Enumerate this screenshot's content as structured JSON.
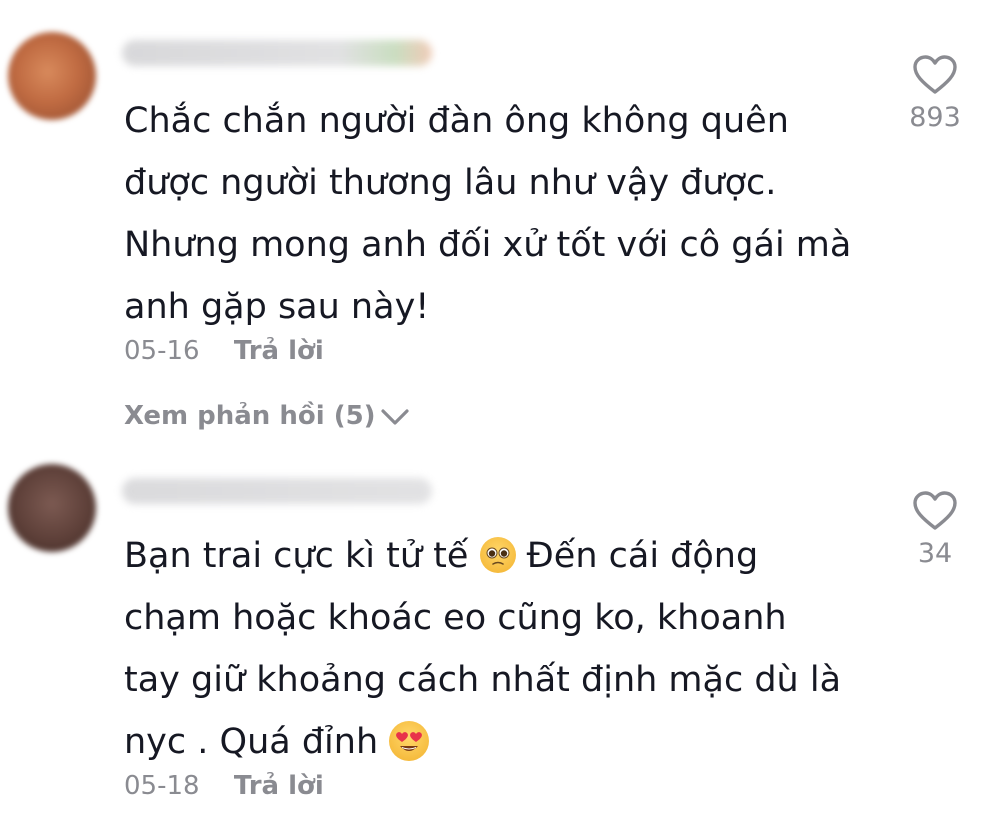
{
  "comments": [
    {
      "lines": [
        "Chắc chắn người đàn ông không quên",
        "được người thương lâu như vậy được.",
        "Nhưng mong anh đối xử tốt với cô gái mà",
        "anh gặp sau này!"
      ],
      "date": "05-16",
      "reply_label": "Trả lời",
      "likes": "893",
      "view_replies_label": "Xem phản hồi (5)"
    },
    {
      "lines": [
        "Bạn trai cực kì tử tế",
        "Đến cái động",
        "chạm hoặc khoác eo cũng ko, khoanh",
        "tay giữ khoảng cách nhất định mặc dù là",
        "nyc . Quá đỉnh"
      ],
      "date": "05-18",
      "reply_label": "Trả lời",
      "likes": "34"
    }
  ],
  "icons": {
    "like": "heart-outline-icon",
    "expand": "chevron-down-icon",
    "emoji_1": "pleading-face-emoji",
    "emoji_2": "heart-eyes-emoji"
  },
  "colors": {
    "text": "#161823",
    "meta": "#8a8b91",
    "icon": "#8a8b91"
  }
}
